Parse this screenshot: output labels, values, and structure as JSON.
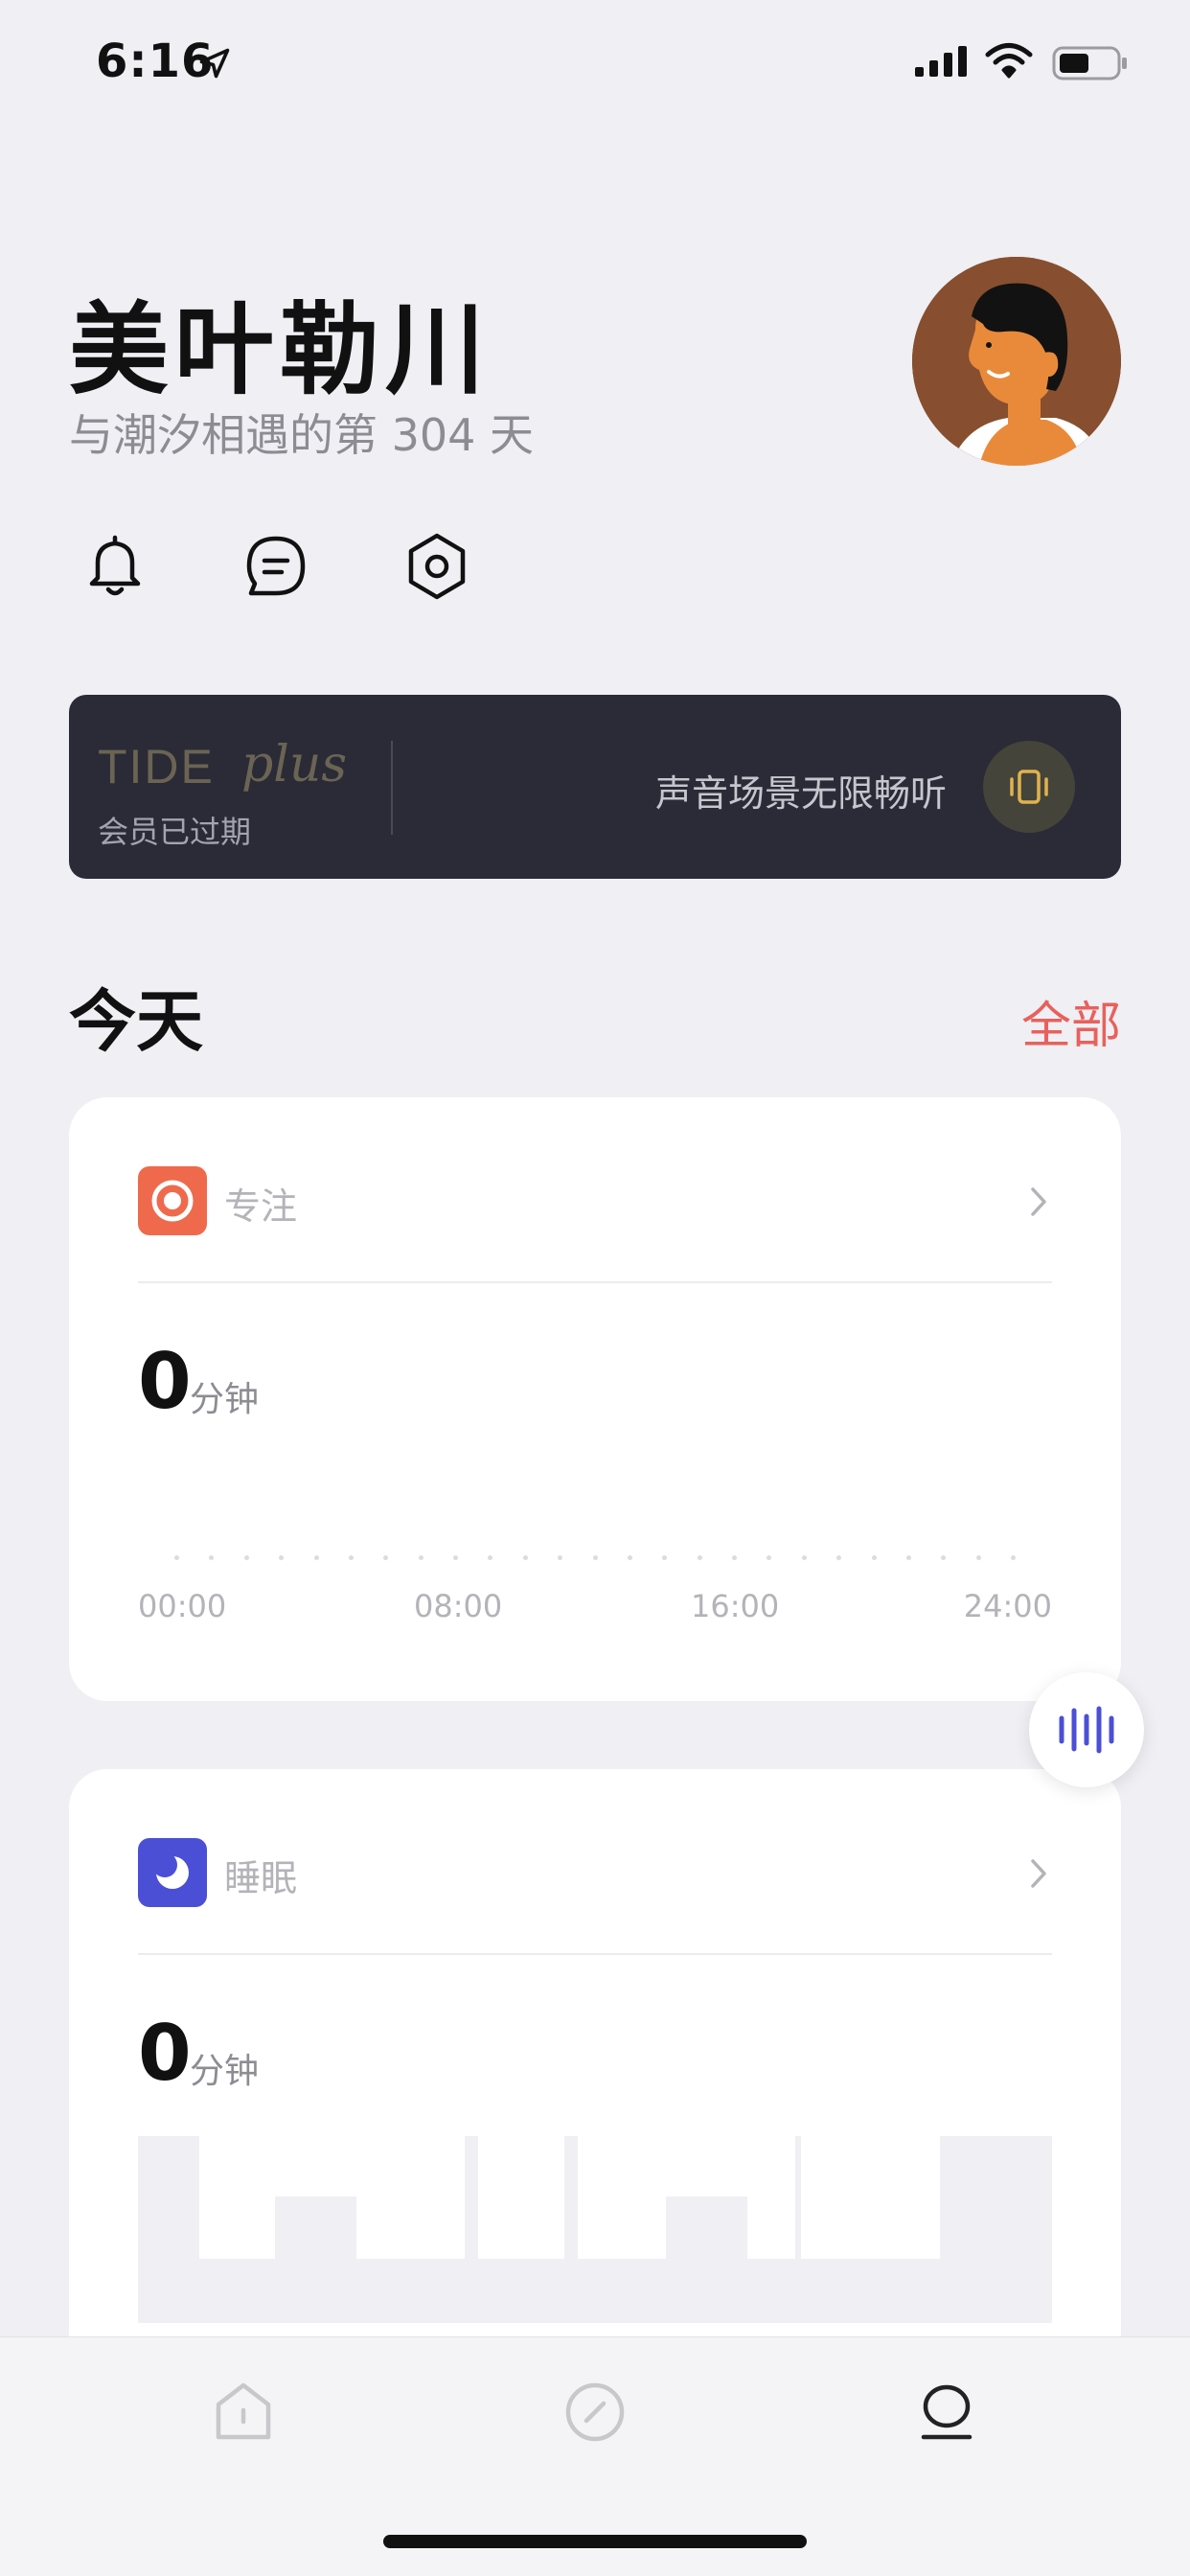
{
  "status_bar": {
    "time": "6:16"
  },
  "profile": {
    "name": "美叶勒川",
    "days_text": "与潮汐相遇的第 304 天"
  },
  "toolbar": {
    "icons": [
      "bell-icon",
      "message-icon",
      "settings-icon"
    ]
  },
  "plus_banner": {
    "logo_text": "TIDE",
    "logo_script": "plus",
    "status": "会员已过期",
    "tagline": "声音场景无限畅听"
  },
  "today": {
    "title": "今天",
    "all_label": "全部"
  },
  "focus_card": {
    "label": "专注",
    "value": "0",
    "unit": "分钟",
    "axis_labels": [
      "00:00",
      "08:00",
      "16:00",
      "24:00"
    ],
    "accent": "#ef6a4c"
  },
  "sleep_card": {
    "label": "睡眠",
    "value": "0",
    "unit": "分钟",
    "accent": "#4b4fd6"
  },
  "tab_bar": {
    "tabs": [
      "home-tab",
      "explore-tab",
      "profile-tab"
    ],
    "active": "profile-tab"
  },
  "colors": {
    "accent_red": "#e8615c",
    "banner_bg": "#2a2b36",
    "page_bg": "#efeff4"
  }
}
